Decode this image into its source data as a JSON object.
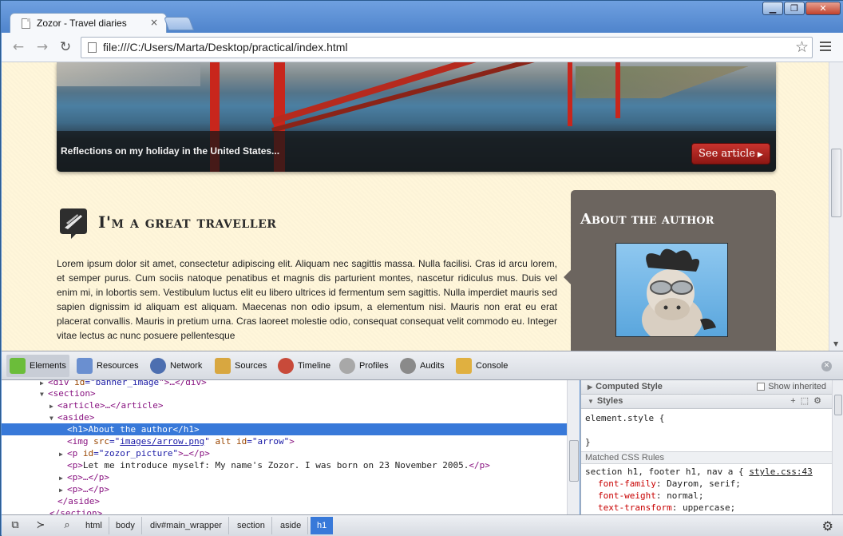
{
  "browser": {
    "tab_title": "Zozor - Travel diaries",
    "tab_close": "×",
    "url": "file:///C:/Users/Marta/Desktop/practical/index.html",
    "window_buttons": [
      "▁",
      "❐",
      "✕"
    ]
  },
  "page": {
    "banner_caption": "Reflections on my holiday in the United States...",
    "see_article": "See article",
    "article_heading": "I'm a great traveller",
    "article_text": "Lorem ipsum dolor sit amet, consectetur adipiscing elit. Aliquam nec sagittis massa. Nulla facilisi. Cras id arcu lorem, et semper purus. Cum sociis natoque penatibus et magnis dis parturient montes, nascetur ridiculus mus. Duis vel enim mi, in lobortis sem. Vestibulum luctus elit eu libero ultrices id fermentum sem sagittis. Nulla imperdiet mauris sed sapien dignissim id aliquam est aliquam. Maecenas non odio ipsum, a elementum nisi. Mauris non erat eu erat placerat convallis. Mauris in pretium urna. Cras laoreet molestie odio, consequat consequat velit commodo eu. Integer vitae lectus ac nunc posuere pellentesque",
    "aside_title": "About the author"
  },
  "devtools": {
    "tabs": [
      {
        "label": "Elements",
        "color": "#6bbd3a"
      },
      {
        "label": "Resources",
        "color": "#6a8fd0"
      },
      {
        "label": "Network",
        "color": "#4d6fb0"
      },
      {
        "label": "Sources",
        "color": "#d8a740"
      },
      {
        "label": "Timeline",
        "color": "#c84a3a"
      },
      {
        "label": "Profiles",
        "color": "#a8a8a8"
      },
      {
        "label": "Audits",
        "color": "#8a8a8a"
      },
      {
        "label": "Console",
        "color": "#e0b040"
      }
    ],
    "dom": {
      "line0": {
        "open": "<div ",
        "attr": "id",
        "eq": "=\"",
        "val": "banner_image",
        "close": "\">…</div>"
      },
      "line1": "<section>",
      "line2": "<article>…</article>",
      "line3": "<aside>",
      "line4": "<h1>About the author</h1>",
      "line5": {
        "open": "<img ",
        "a1": "src",
        "v1": "images/arrow.png",
        "a2": "alt",
        "a3": "id",
        "v3": "arrow",
        "close": ">"
      },
      "line6": {
        "open": "<p ",
        "attr": "id",
        "val": "zozor_picture",
        "close": ">…</p>"
      },
      "line7": {
        "open": "<p>",
        "text": "Let me introduce myself: My name's Zozor. I was born on 23 November 2005.",
        "close": "</p>"
      },
      "line8": "<p>…</p>",
      "line9": "<p>…</p>",
      "line10": "</aside>",
      "line11": "</section>"
    },
    "styles": {
      "computed_header": "Computed Style",
      "show_inherited": "Show inherited",
      "styles_header": "Styles",
      "element_style_open": "element.style {",
      "element_style_close": "}",
      "matched_header": "Matched CSS Rules",
      "rule_selector": "section h1, footer h1, nav a {",
      "rule_source": "style.css:43",
      "props": [
        {
          "name": "font-family",
          "value": "Dayrom, serif;"
        },
        {
          "name": "font-weight",
          "value": "normal;"
        },
        {
          "name": "text-transform",
          "value": "uppercase;"
        }
      ]
    },
    "breadcrumbs": [
      "html",
      "body",
      "div#main_wrapper",
      "section",
      "aside",
      "h1"
    ]
  }
}
